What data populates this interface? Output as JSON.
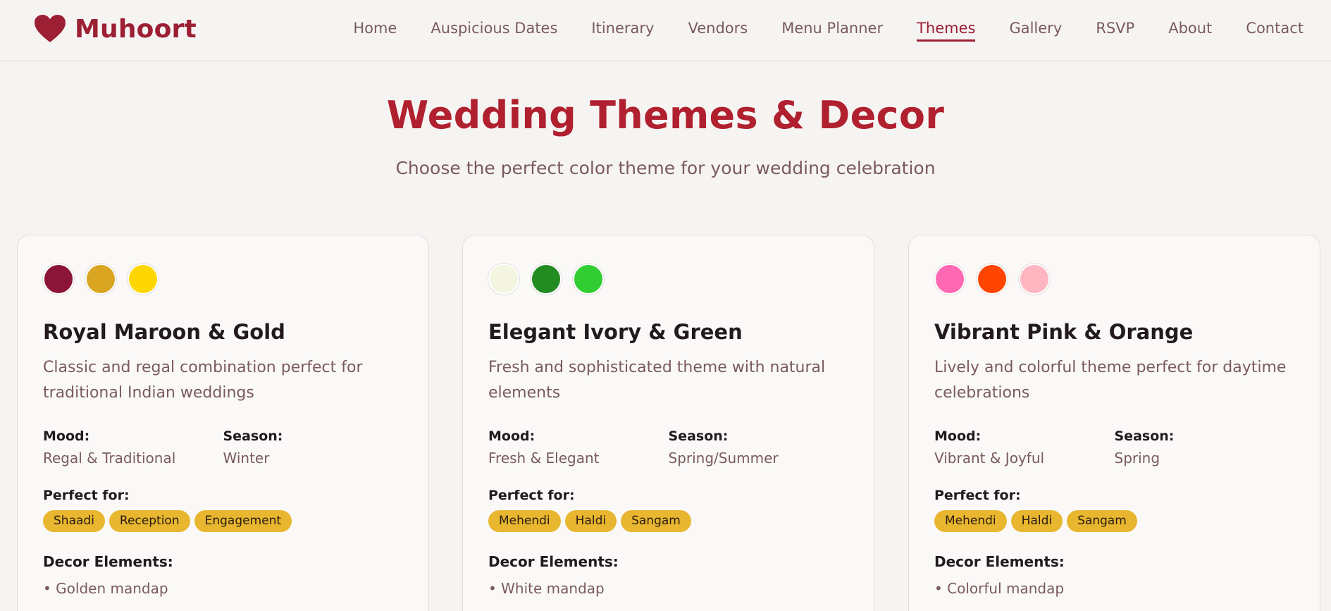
{
  "brand": {
    "name": "Muhoort",
    "icon": "heart-icon",
    "color": "#9c1f34"
  },
  "nav": {
    "items": [
      {
        "label": "Home",
        "active": false
      },
      {
        "label": "Auspicious Dates",
        "active": false
      },
      {
        "label": "Itinerary",
        "active": false
      },
      {
        "label": "Vendors",
        "active": false
      },
      {
        "label": "Menu Planner",
        "active": false
      },
      {
        "label": "Themes",
        "active": true
      },
      {
        "label": "Gallery",
        "active": false
      },
      {
        "label": "RSVP",
        "active": false
      },
      {
        "label": "About",
        "active": false
      },
      {
        "label": "Contact",
        "active": false
      }
    ]
  },
  "hero": {
    "title": "Wedding Themes & Decor",
    "subtitle": "Choose the perfect color theme for your wedding celebration"
  },
  "labels": {
    "mood": "Mood:",
    "season": "Season:",
    "perfect_for": "Perfect for:",
    "decor": "Decor Elements:"
  },
  "themes": [
    {
      "colors": [
        "#8b1538",
        "#daa520",
        "#ffd700"
      ],
      "title": "Royal Maroon & Gold",
      "description": "Classic and regal combination perfect for traditional Indian weddings",
      "mood": "Regal & Traditional",
      "season": "Winter",
      "tags": [
        "Shaadi",
        "Reception",
        "Engagement"
      ],
      "decor": [
        "• Golden mandap"
      ]
    },
    {
      "colors": [
        "#f4f5e0",
        "#228b22",
        "#32cd32"
      ],
      "title": "Elegant Ivory & Green",
      "description": "Fresh and sophisticated theme with natural elements",
      "mood": "Fresh & Elegant",
      "season": "Spring/Summer",
      "tags": [
        "Mehendi",
        "Haldi",
        "Sangam"
      ],
      "decor": [
        "• White mandap"
      ]
    },
    {
      "colors": [
        "#ff69b4",
        "#ff4500",
        "#ffb6c1"
      ],
      "title": "Vibrant Pink & Orange",
      "description": "Lively and colorful theme perfect for daytime celebrations",
      "mood": "Vibrant & Joyful",
      "season": "Spring",
      "tags": [
        "Mehendi",
        "Haldi",
        "Sangam"
      ],
      "decor": [
        "• Colorful mandap"
      ]
    }
  ],
  "colors": {
    "accent": "#9c1f34",
    "title": "#b0202e",
    "muted_text": "#7a5a5e",
    "tag_bg": "#e8b62f",
    "page_bg": "#f6f4f3"
  }
}
